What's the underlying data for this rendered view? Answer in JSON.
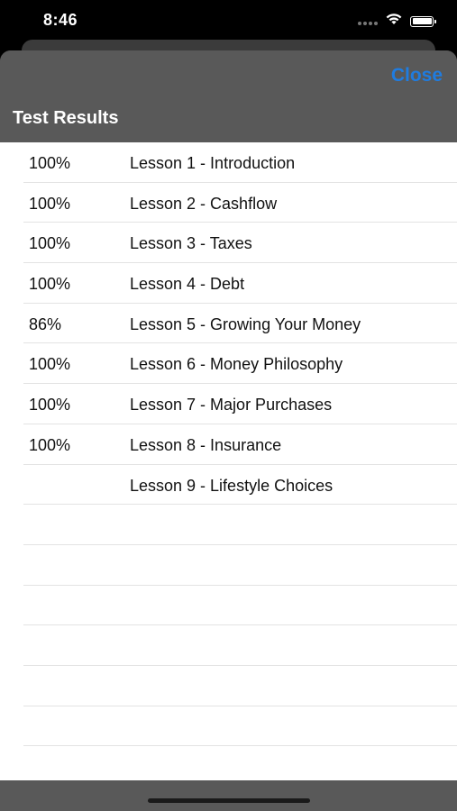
{
  "status_bar": {
    "time": "8:46",
    "icons": [
      "cellular-signal-icon",
      "wifi-icon",
      "battery-icon"
    ]
  },
  "header": {
    "close_label": "Close",
    "title": "Test Results",
    "accent_color": "#1f7ce0"
  },
  "results": [
    {
      "score": "100%",
      "lesson": "Lesson 1 - Introduction"
    },
    {
      "score": "100%",
      "lesson": "Lesson 2 - Cashflow"
    },
    {
      "score": "100%",
      "lesson": "Lesson 3 - Taxes"
    },
    {
      "score": "100%",
      "lesson": "Lesson 4 - Debt"
    },
    {
      "score": "86%",
      "lesson": "Lesson 5 - Growing Your Money"
    },
    {
      "score": "100%",
      "lesson": "Lesson 6 - Money Philosophy"
    },
    {
      "score": "100%",
      "lesson": "Lesson 7 - Major Purchases"
    },
    {
      "score": "100%",
      "lesson": "Lesson 8 - Insurance"
    },
    {
      "score": "",
      "lesson": "Lesson 9 - Lifestyle Choices"
    },
    {
      "score": "",
      "lesson": ""
    },
    {
      "score": "",
      "lesson": ""
    },
    {
      "score": "",
      "lesson": ""
    },
    {
      "score": "",
      "lesson": ""
    },
    {
      "score": "",
      "lesson": ""
    },
    {
      "score": "",
      "lesson": ""
    },
    {
      "score": "",
      "lesson": ""
    }
  ]
}
